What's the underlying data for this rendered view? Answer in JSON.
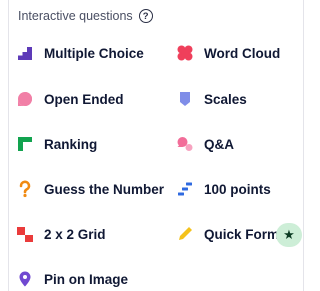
{
  "header": {
    "title": "Interactive questions",
    "help_icon": "question-circle-icon",
    "help_glyph": "?"
  },
  "items": [
    {
      "label": "Multiple Choice",
      "icon": "bar-chart-icon",
      "color": "#5d3ab8"
    },
    {
      "label": "Word Cloud",
      "icon": "cloud-cluster-icon",
      "color": "#ef3f5b"
    },
    {
      "label": "Open Ended",
      "icon": "speech-bubble-icon",
      "color": "#f17fa6"
    },
    {
      "label": "Scales",
      "icon": "scales-icon",
      "color": "#7f8de8"
    },
    {
      "label": "Ranking",
      "icon": "ranking-icon",
      "color": "#12a34f"
    },
    {
      "label": "Q&A",
      "icon": "qa-bubbles-icon",
      "color": "#f26d99"
    },
    {
      "label": "Guess the Number",
      "icon": "question-mark-icon",
      "color": "#f08a12"
    },
    {
      "label": "100 points",
      "icon": "staircase-bars-icon",
      "color": "#2f6ae0"
    },
    {
      "label": "2 x 2 Grid",
      "icon": "grid-2x2-icon",
      "color": "#ea3b3b"
    },
    {
      "label": "Quick Form",
      "icon": "pencil-icon",
      "color": "#f4c21c"
    },
    {
      "label": "Pin on Image",
      "icon": "location-pin-icon",
      "color": "#7048d1"
    }
  ],
  "quick_form_badge": {
    "icon": "star-icon",
    "glyph": "★",
    "color": "#cdeed7"
  }
}
